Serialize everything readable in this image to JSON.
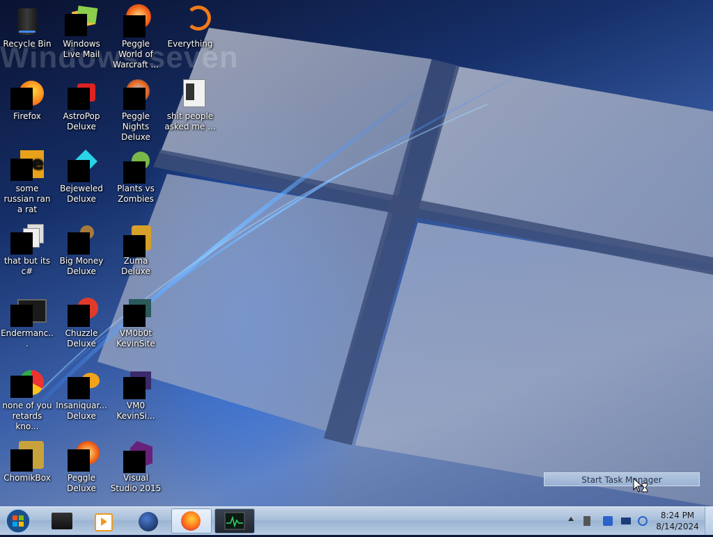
{
  "wallpaper": {
    "watermark": "Windows seven"
  },
  "desktop_icons": [
    {
      "label": "Recycle Bin",
      "icon": "recycle-bin-icon"
    },
    {
      "label": "Windows Live Mail",
      "icon": "windows-live-mail-icon"
    },
    {
      "label": "Peggle World of Warcraft ...",
      "icon": "peggle-icon"
    },
    {
      "label": "Everything",
      "icon": "everything-icon"
    },
    {
      "label": "Firefox",
      "icon": "firefox-icon"
    },
    {
      "label": "AstroPop Deluxe",
      "icon": "astropop-icon"
    },
    {
      "label": "Peggle Nights Deluxe",
      "icon": "peggle-nights-icon"
    },
    {
      "label": "shit people asked me ...",
      "icon": "file-icon"
    },
    {
      "label": "some russian ran a rat",
      "icon": "document-icon"
    },
    {
      "label": "Bejeweled Deluxe",
      "icon": "bejeweled-icon"
    },
    {
      "label": "Plants vs Zombies",
      "icon": "plants-vs-zombies-icon"
    },
    {
      "label": "that but its c#",
      "icon": "files-icon"
    },
    {
      "label": "Big Money Deluxe",
      "icon": "big-money-icon"
    },
    {
      "label": "Zuma Deluxe",
      "icon": "zuma-icon"
    },
    {
      "label": "Endermanc...",
      "icon": "terminal-icon"
    },
    {
      "label": "Chuzzle Deluxe",
      "icon": "chuzzle-icon"
    },
    {
      "label": "VM0b0t KevinSite",
      "icon": "shortcut-icon"
    },
    {
      "label": "none of you retards kno...",
      "icon": "chrome-icon"
    },
    {
      "label": "Insaniquar... Deluxe",
      "icon": "insaniquarium-icon"
    },
    {
      "label": "VM0 KevinSi...",
      "icon": "shortcut-icon"
    },
    {
      "label": "ChomikBox",
      "icon": "chomikbox-icon"
    },
    {
      "label": "Peggle Deluxe",
      "icon": "peggle-icon"
    },
    {
      "label": "Visual Studio 2015",
      "icon": "visual-studio-icon"
    }
  ],
  "taskbar": {
    "pinned": [
      {
        "name": "start-button",
        "icon": "windows-orb-icon"
      },
      {
        "name": "taskbar-app-1",
        "icon": "black-box-icon"
      },
      {
        "name": "taskbar-app-2",
        "icon": "media-player-icon"
      },
      {
        "name": "taskbar-app-3",
        "icon": "globe-icon"
      },
      {
        "name": "taskbar-app-firefox",
        "icon": "firefox-icon"
      },
      {
        "name": "taskbar-app-task-manager",
        "icon": "task-manager-icon"
      }
    ],
    "tray_icons": [
      "show-hidden-icons-chevron",
      "battery-icon",
      "network-icon",
      "display-icon",
      "volume-icon"
    ],
    "clock": {
      "time": "8:24 PM",
      "date": "8/14/2024"
    }
  },
  "tooltip": {
    "text": "Start Task Manager"
  },
  "colors": {
    "taskbar": "#a8bfd9",
    "accent": "#3b7be8"
  }
}
